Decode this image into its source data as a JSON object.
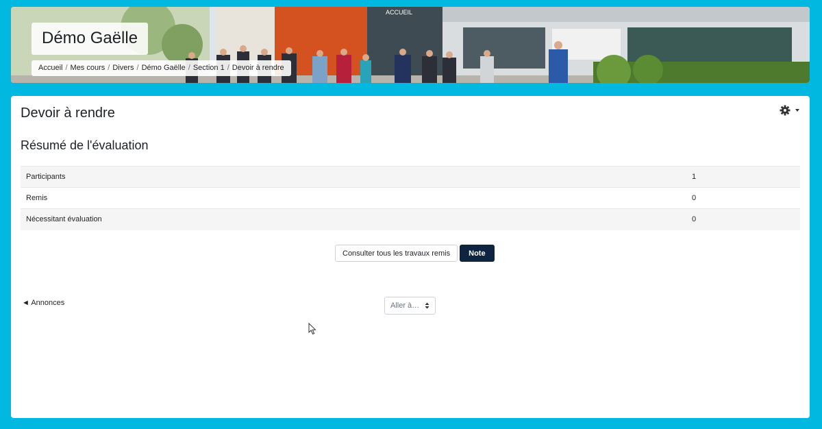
{
  "header": {
    "site_title": "Démo Gaëlle",
    "banner_sign": "ACCUEIL",
    "breadcrumb": [
      "Accueil",
      "Mes cours",
      "Divers",
      "Démo Gaëlle",
      "Section 1",
      "Devoir à rendre"
    ]
  },
  "main": {
    "title": "Devoir à rendre",
    "settings_icon": "gear-icon",
    "summary_title": "Résumé de l'évaluation",
    "summary_rows": [
      {
        "label": "Participants",
        "value": "1"
      },
      {
        "label": "Remis",
        "value": "0"
      },
      {
        "label": "Nécessitant évaluation",
        "value": "0"
      }
    ],
    "buttons": {
      "view_all": "Consulter tous les travaux remis",
      "grade": "Note"
    },
    "nav": {
      "prev_arrow": "◄",
      "prev_label": "Annonces",
      "jump_placeholder": "Aller à…"
    }
  },
  "colors": {
    "page_background": "#00b8e0",
    "primary_button": "#0f2440"
  }
}
